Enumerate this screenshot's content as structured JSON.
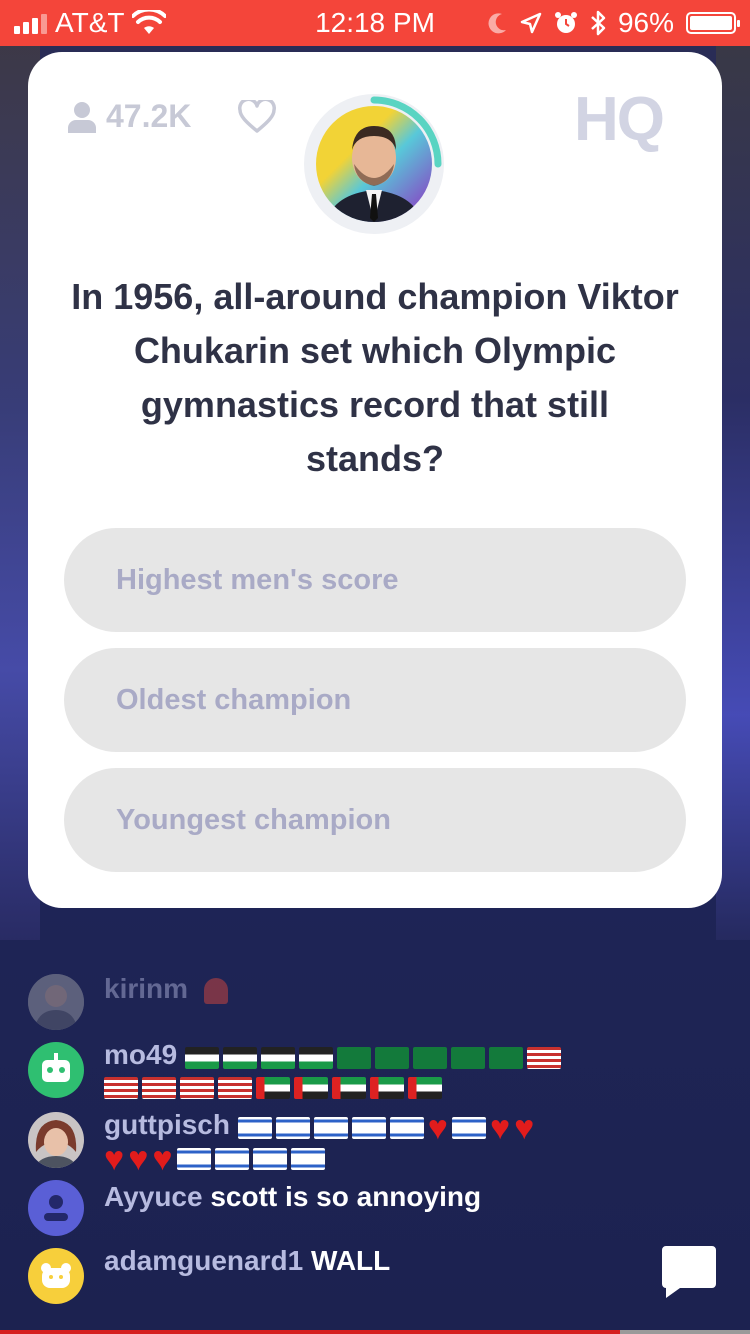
{
  "status_bar": {
    "carrier": "AT&T",
    "time": "12:18 PM",
    "battery": "96%",
    "battery_level": 0.96,
    "background": "#f4453a"
  },
  "header": {
    "viewer_count": "47.2K",
    "logo": "HQ"
  },
  "question": {
    "text": "In 1956, all-around champion Viktor Chukarin set which Olympic gymnastics record that still stands?"
  },
  "answers": [
    {
      "label": "Highest men's score"
    },
    {
      "label": "Oldest champion"
    },
    {
      "label": "Youngest champion"
    }
  ],
  "chat": [
    {
      "username": "kirinm",
      "message": "",
      "avatar": "photo"
    },
    {
      "username": "mo49",
      "message": "",
      "avatar": "robot-icon",
      "emoji_lines": [
        [
          "ps",
          "ps",
          "ps",
          "ps",
          "sa",
          "sa",
          "sa",
          "sa",
          "sa",
          "us"
        ],
        [
          "us",
          "us",
          "us",
          "us",
          "ae",
          "ae",
          "ae",
          "ae",
          "ae"
        ]
      ]
    },
    {
      "username": "guttpisch",
      "message": "",
      "avatar": "photo",
      "emoji_lines": [
        [
          "il",
          "il",
          "il",
          "il",
          "il",
          "heart",
          "il",
          "heart",
          "heart"
        ],
        [
          "heart",
          "heart",
          "heart",
          "il",
          "il",
          "il",
          "il"
        ]
      ]
    },
    {
      "username": "Ayyuce",
      "message": "scott is so annoying",
      "avatar": "user-icon"
    },
    {
      "username": "adamguenard1",
      "message": "WALL",
      "avatar": "bear-icon"
    }
  ],
  "colors": {
    "card": "#ffffff",
    "answer_bg": "#e6e6e6",
    "answer_text": "#a9aac6",
    "question_text": "#2f3246",
    "username": "#b7bbe0",
    "robot_avatar": "#2fbf71",
    "user_avatar": "#5a5fd6",
    "bear_avatar": "#f7cf3b"
  }
}
